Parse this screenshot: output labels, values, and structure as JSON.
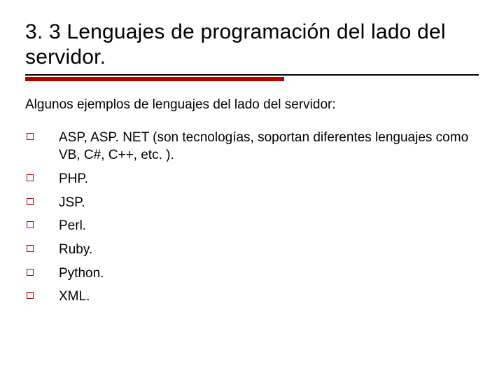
{
  "colors": {
    "accent": "#b00000",
    "rule_thin": "#000000"
  },
  "title": "3. 3 Lenguajes de programación del lado del servidor.",
  "intro": "Algunos ejemplos de lenguajes del lado del servidor:",
  "items": [
    "ASP, ASP. NET  (son tecnologías, soportan diferentes lenguajes como VB, C#, C++, etc. ).",
    "PHP.",
    "JSP.",
    "Perl.",
    "Ruby.",
    "Python.",
    "XML."
  ]
}
